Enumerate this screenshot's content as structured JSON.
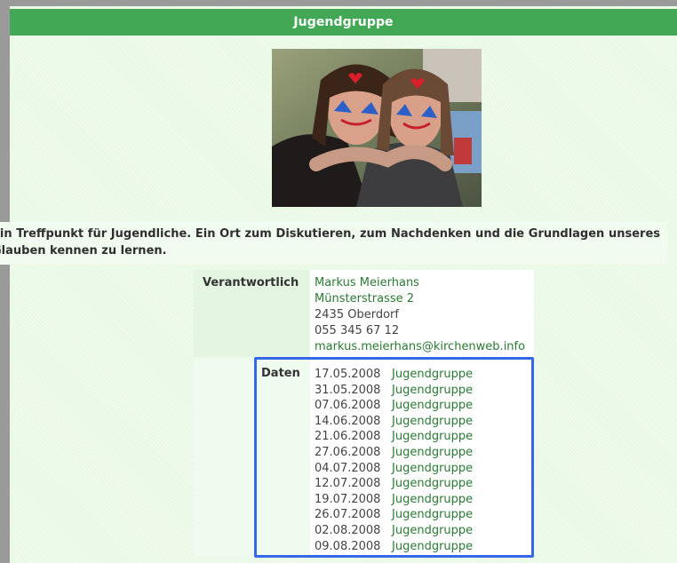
{
  "page": {
    "title": "Jugendgruppe",
    "photo_alt": "Zwei Mädchen mit bemalten Gesichtern",
    "intro": "Ein Treffpunkt für Jugendliche. Ein Ort zum Diskutieren, zum Nachdenken und die Grundlagen unseres Glauben kennen zu lernen."
  },
  "contact": {
    "label": "Verantwortlich",
    "name": "Markus Meierhans",
    "street": "Münsterstrasse 2",
    "city": "2435 Oberdorf",
    "phone": "055 345 67 12",
    "email": "markus.meierhans@kirchenweb.info"
  },
  "dates": {
    "label": "Daten",
    "items": [
      {
        "date": "17.05.2008",
        "event": "Jugendgruppe"
      },
      {
        "date": "31.05.2008",
        "event": "Jugendgruppe"
      },
      {
        "date": "07.06.2008",
        "event": "Jugendgruppe"
      },
      {
        "date": "14.06.2008",
        "event": "Jugendgruppe"
      },
      {
        "date": "21.06.2008",
        "event": "Jugendgruppe"
      },
      {
        "date": "27.06.2008",
        "event": "Jugendgruppe"
      },
      {
        "date": "04.07.2008",
        "event": "Jugendgruppe"
      },
      {
        "date": "12.07.2008",
        "event": "Jugendgruppe"
      },
      {
        "date": "19.07.2008",
        "event": "Jugendgruppe"
      },
      {
        "date": "26.07.2008",
        "event": "Jugendgruppe"
      },
      {
        "date": "02.08.2008",
        "event": "Jugendgruppe"
      },
      {
        "date": "09.08.2008",
        "event": "Jugendgruppe"
      }
    ]
  },
  "colors": {
    "header_green": "#43a856",
    "link_green": "#2b7a34",
    "highlight_blue": "#3568e8",
    "page_background": "#e9f9e6"
  }
}
